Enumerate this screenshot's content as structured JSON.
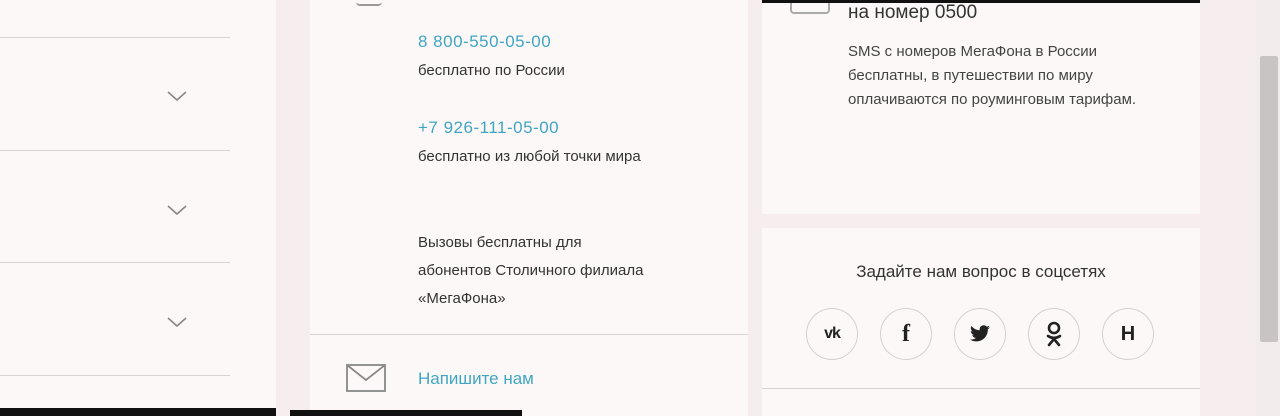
{
  "left_column": {
    "accordion_items": [
      {
        "id": "item-1"
      },
      {
        "id": "item-2"
      },
      {
        "id": "item-3"
      }
    ]
  },
  "phones": [
    {
      "number": "8 800-550-05-00",
      "note": "бесплатно по России"
    },
    {
      "number": "+7 926-111-05-00",
      "note": "бесплатно из любой точки мира"
    }
  ],
  "phones_footnote": "Вызовы бесплатны для абонентов Столичного филиала «МегаФона»",
  "mail": {
    "label": "Напишите нам",
    "icon": "envelope-icon"
  },
  "sms": {
    "title": "на номер 0500",
    "text": "SMS с номеров МегаФона в России бесплатны, в путешествии по миру оплачиваются по роуминговым тарифам."
  },
  "social": {
    "title": "Задайте нам вопрос в соцсетях",
    "networks": [
      {
        "glyph": "vk",
        "icon": "vk-icon"
      },
      {
        "glyph": "f",
        "icon": "facebook-icon"
      },
      {
        "glyph": "🐦",
        "icon": "twitter-icon"
      },
      {
        "glyph": "ok",
        "icon": "odnoklassniki-icon"
      },
      {
        "glyph": "H",
        "icon": "habr-icon"
      }
    ]
  },
  "colors": {
    "accent": "#3fa6c2",
    "background": "#f6eeee",
    "card": "#fdf8f8"
  }
}
